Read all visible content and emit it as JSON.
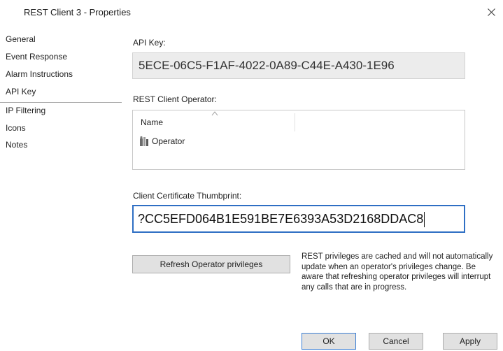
{
  "window": {
    "title": "REST Client 3 - Properties",
    "close_glyph": "✕"
  },
  "nav": {
    "items": [
      {
        "label": "General"
      },
      {
        "label": "Event Response"
      },
      {
        "label": "Alarm Instructions"
      },
      {
        "label": "API Key",
        "selected": true
      },
      {
        "label": "IP Filtering"
      },
      {
        "label": "Icons"
      },
      {
        "label": "Notes"
      }
    ]
  },
  "api_key": {
    "label": "API Key:",
    "value": "5ECE-06C5-F1AF-4022-0A89-C44E-A430-1E96"
  },
  "operator": {
    "label": "REST Client Operator:",
    "column_name": "Name",
    "rows": [
      {
        "name": "Operator",
        "icon": "operator-icon"
      }
    ]
  },
  "thumbprint": {
    "label": "Client Certificate Thumbprint:",
    "value": "?CC5EFD064B1E591BE7E6393A53D2168DDAC8"
  },
  "refresh": {
    "button_label": "Refresh Operator privileges",
    "note": "REST privileges are cached and will not automatically update when an operator's privileges change. Be aware that refreshing operator privileges will interrupt any calls that are in progress."
  },
  "footer": {
    "ok_label": "OK",
    "cancel_label": "Cancel",
    "apply_label": "Apply"
  },
  "colors": {
    "focus_border": "#2f6fc4",
    "readonly_bg": "#ececec",
    "button_bg": "#e1e1e1"
  }
}
